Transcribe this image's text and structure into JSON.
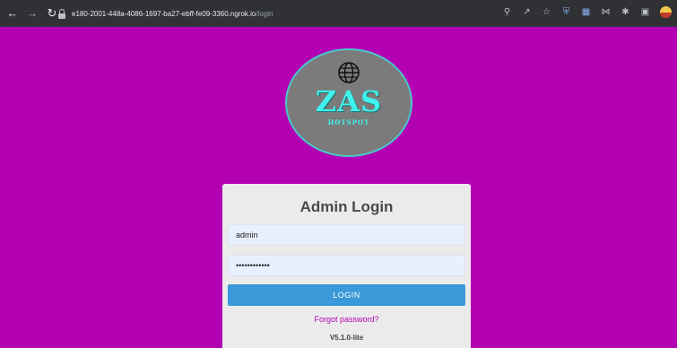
{
  "browser": {
    "url_host": "e180-2001-448a-4086-1697-ba27-ebff-fe09-3360.ngrok.io",
    "url_path": "/login",
    "back_icon": "arrow-left-icon",
    "forward_icon": "arrow-right-icon",
    "reload_icon": "reload-icon",
    "toolbar_icons": [
      "key-icon",
      "share-icon",
      "star-icon",
      "shield-extension-icon",
      "extension-icon",
      "network-extension-icon",
      "puzzle-icon",
      "sidebar-icon",
      "profile-avatar"
    ]
  },
  "logo": {
    "title": "ZAS",
    "subtitle": "HOTSPOT",
    "icon": "globe-icon",
    "bg_color": "#7b7b7b",
    "text_color": "#3ff2ee"
  },
  "login": {
    "title": "Admin Login",
    "username_value": "admin",
    "password_value": "••••••••••••",
    "button_label": "LOGIN",
    "forgot_label": "Forgot password?",
    "version": "V5.1.0-lite"
  },
  "colors": {
    "page_bg": "#b300b3",
    "button_bg": "#3a99d9",
    "card_bg": "#ebebeb"
  }
}
